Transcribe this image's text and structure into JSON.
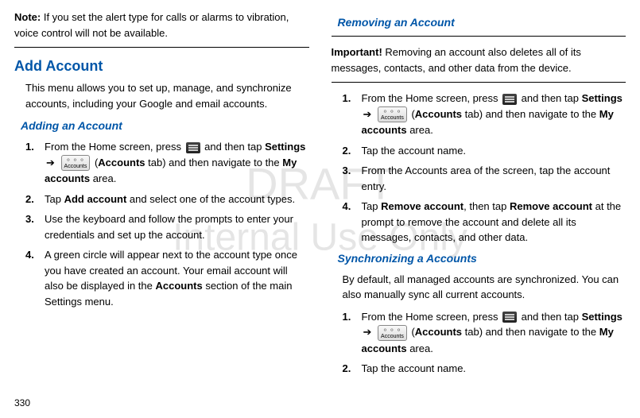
{
  "watermark": {
    "line1": "DRAFT",
    "line2": "Internal Use Only"
  },
  "pageNumber": "330",
  "note": {
    "label": "Note:",
    "text": "If you set the alert type for calls or alarms to vibration, voice control will not be available."
  },
  "heading1": "Add Account",
  "intro1": "This menu allows you to set up, manage, and synchronize accounts, including your Google and email accounts.",
  "subheading1": "Adding an Account",
  "step_prefix": "From the Home screen, press ",
  "step_mid1": " and then tap ",
  "settings": "Settings",
  "arrow": "➔",
  "accounts_icon_label": "Accounts",
  "paren_open": " (",
  "accounts_tab": "Accounts",
  "tab_suffix": " tab) and then navigate to the ",
  "my_accounts": "My accounts",
  "area_suffix": " area.",
  "add_step2a": "Tap ",
  "add_account": "Add account",
  "add_step2b": " and select one of the account types.",
  "add_step3": "Use the keyboard and follow the prompts to enter your credentials and set up the account.",
  "add_step4a": "A green circle will appear next to the account type once you have created an account. Your email account will also be displayed in the ",
  "accounts_bold": "Accounts",
  "add_step4b": " section of the main Settings menu.",
  "subheading2": "Removing an Account",
  "important": {
    "label": "Important!",
    "text": "Removing an account also deletes all of its messages, contacts, and other data from the device."
  },
  "rem_step2": "Tap the account name.",
  "rem_step3": "From the Accounts area of the screen, tap the account entry.",
  "rem_step4a": "Tap ",
  "remove_account": "Remove account",
  "rem_step4b": ", then tap ",
  "rem_step4c": " at the prompt to remove the account and delete all its messages, contacts, and other data.",
  "subheading3": "Synchronizing a Accounts",
  "sync_intro": "By default, all managed accounts are synchronized. You can also manually sync all current accounts.",
  "sync_step2": "Tap the account name.",
  "nums": {
    "n1": "1.",
    "n2": "2.",
    "n3": "3.",
    "n4": "4."
  }
}
